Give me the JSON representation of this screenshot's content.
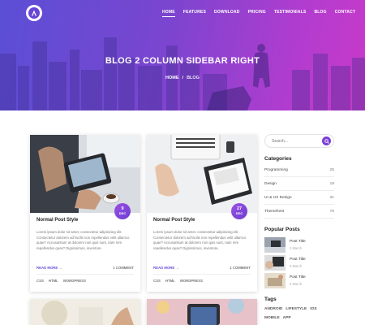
{
  "nav": {
    "items": [
      "HOME",
      "FEATURES",
      "DOWNLOAD",
      "PRICING",
      "TESTIMONIALS",
      "BLOG",
      "CONTACT"
    ]
  },
  "hero": {
    "title": "BLOG 2 COLUMN SIDEBAR RIGHT",
    "breadcrumb": {
      "home": "HOME",
      "separator": "/",
      "current": "BLOG"
    }
  },
  "posts": [
    {
      "title": "Normal Post Style",
      "day": "9",
      "month": "DEC",
      "excerpt": "Lorem ipsum dolor sit amet, consectetur adipisicing elit. Consectetur dolorem ad facilis non repellendus velit ullamco quae? Accusantium at dolorem non quis sunt, nam rem repellendus quas? Dignissimos, inventore.",
      "read_more": "READ MORE →",
      "comments": "1 COMMENT",
      "tags": [
        "CSS",
        "HTML",
        "WORDPRESS"
      ]
    },
    {
      "title": "Normal Post Style",
      "day": "27",
      "month": "DEC",
      "excerpt": "Lorem ipsum dolor sit amet, consectetur adipisicing elit. Consectetur dolorem ad facilis non repellendus velit ullamco quae? Accusantium at dolorem non quis sunt, nam rem repellendus quas? Dignissimos, inventore.",
      "read_more": "READ MORE →",
      "comments": "1 COMMENT",
      "tags": [
        "CSS",
        "HTML",
        "WORDPRESS"
      ]
    }
  ],
  "sidebar": {
    "search_placeholder": "Search...",
    "categories_title": "Categories",
    "categories": [
      {
        "name": "Programming",
        "count": "25"
      },
      {
        "name": "Design",
        "count": "19"
      },
      {
        "name": "UI & UX Design",
        "count": "31"
      },
      {
        "name": "Themeforst",
        "count": "76"
      }
    ],
    "popular_title": "Popular Posts",
    "popular": [
      {
        "title": "Post Title",
        "date": "3 March"
      },
      {
        "title": "Post Title",
        "date": "6 March"
      },
      {
        "title": "Post Title",
        "date": "5 March"
      }
    ],
    "tags_title": "Tags",
    "tags_row1": [
      "ANDROID",
      "LIFESTYLE",
      "IOS"
    ],
    "tags_row2": [
      "MOBILE",
      "APP"
    ]
  },
  "colors": {
    "accent": "#7c3fd6",
    "hero_from": "#5b4fd6",
    "hero_to": "#c83ac9"
  }
}
